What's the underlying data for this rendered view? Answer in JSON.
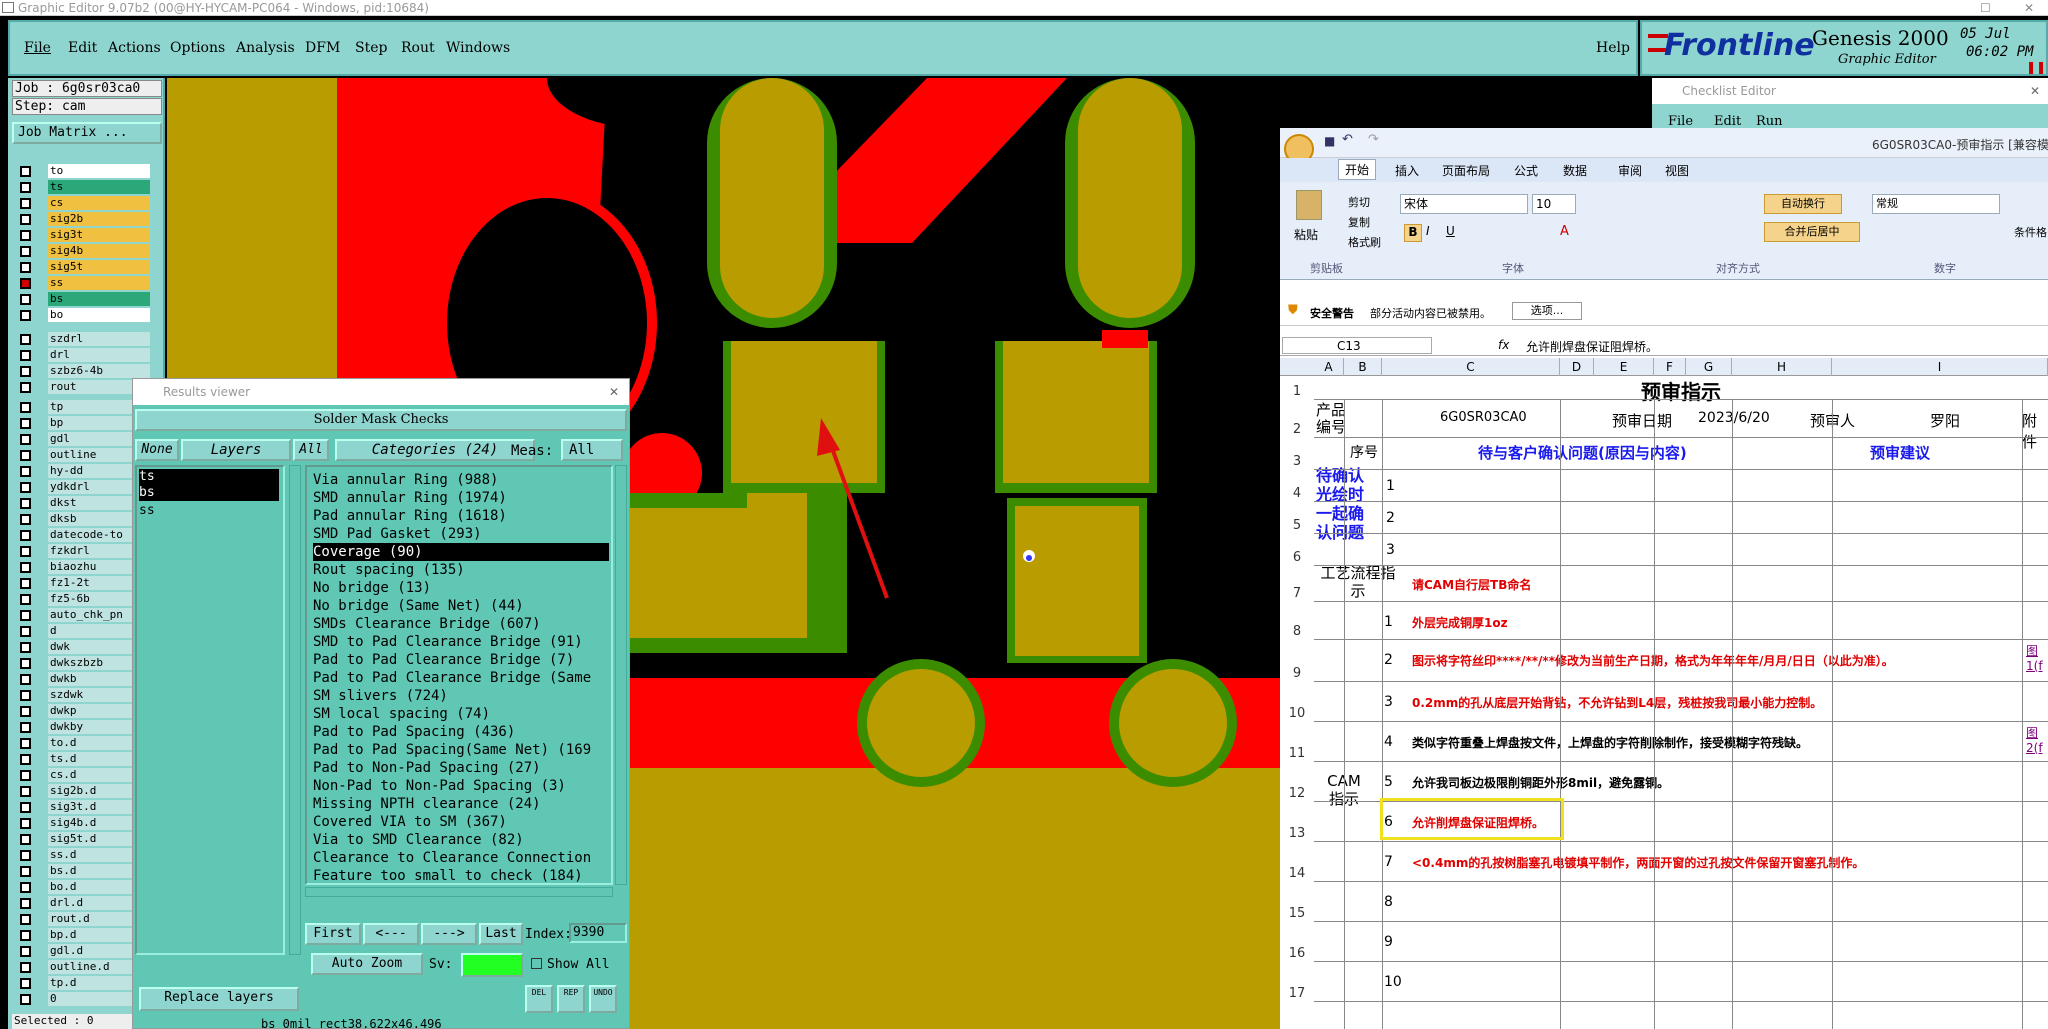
{
  "app": {
    "title": "Graphic Editor 9.07b2 (00@HY-HYCAM-PC064 - Windows, pid:10684)",
    "help": "Help"
  },
  "menu": [
    "File",
    "Edit",
    "Actions",
    "Options",
    "Analysis",
    "DFM",
    "Step",
    "Rout",
    "Windows"
  ],
  "logo": {
    "brand": "Frontline",
    "product": "Genesis 2000",
    "sub": "Graphic Editor",
    "date": "05 Jul",
    "time": "06:02 PM"
  },
  "job": {
    "job_label": "Job : 6g0sr03ca0",
    "step_label": "Step: cam",
    "matrix_button": "Job Matrix ...",
    "selected": "Selected : 0"
  },
  "layers": [
    "to",
    "ts",
    "cs",
    "sig2b",
    "sig3t",
    "sig4b",
    "sig5t",
    "ss",
    "bs",
    "bo",
    "szdrl",
    "drl",
    "szbz6-4b",
    "rout",
    "tp",
    "bp",
    "gdl",
    "outline",
    "hy-dd",
    "ydkdrl",
    "dkst",
    "dksb",
    "datecode-to",
    "fzkdrl",
    "biaozhu",
    "fz1-2t",
    "fz5-6b",
    "auto_chk_pn",
    "d",
    "dwk",
    "dwkszbzb",
    "dwkb",
    "szdwk",
    "dwkp",
    "dwkby",
    "to.d",
    "ts.d",
    "cs.d",
    "sig2b.d",
    "sig3t.d",
    "sig4b.d",
    "sig5t.d",
    "ss.d",
    "bs.d",
    "bo.d",
    "drl.d",
    "rout.d",
    "bp.d",
    "gdl.d",
    "outline.d",
    "tp.d",
    "0"
  ],
  "layer_colors": {
    "to": "#ffffff",
    "ts": "#2aa87a",
    "cs": "#f0c040",
    "sig2b": "#f0c040",
    "sig3t": "#f0c040",
    "sig4b": "#f0c040",
    "sig5t": "#f0c040",
    "ss": "#f0c040",
    "bs": "#2aa87a",
    "bo": "#ffffff"
  },
  "checklist": {
    "title": "Checklist Editor",
    "menu": [
      "File",
      "Edit",
      "Run"
    ]
  },
  "results": {
    "window_title": "Results viewer",
    "header": "Solder Mask Checks",
    "none_btn": "None",
    "layers_btn": "Layers",
    "all_btn": "All",
    "categories_btn": "Categories (24)",
    "meas_label": "Meas:",
    "meas_value": "All",
    "result_layers": [
      "ts",
      "bs",
      "ss"
    ],
    "categories": [
      "Via annular Ring (988)",
      "SMD annular Ring (1974)",
      "Pad annular Ring (1618)",
      "SMD Pad Gasket (293)",
      "Coverage (90)",
      "Rout spacing (135)",
      "No bridge (13)",
      "No bridge (Same Net) (44)",
      "SMDs Clearance Bridge (607)",
      "SMD to Pad Clearance Bridge (91)",
      "Pad to Pad Clearance Bridge (7)",
      "Pad to Pad Clearance Bridge (Same",
      "SM slivers (724)",
      "SM local spacing (74)",
      "Pad to Pad Spacing (436)",
      "Pad to Pad Spacing(Same Net) (169",
      "Pad to Non-Pad Spacing (27)",
      "Non-Pad to Non-Pad Spacing (3)",
      "Missing NPTH clearance (24)",
      "Covered VIA to SM (367)",
      "Via to SMD Clearance (82)",
      "Clearance to Clearance Connection",
      "Feature too small to check (184)"
    ],
    "selected_category": "Coverage (90)",
    "first": "First",
    "prev": "<---",
    "next": "--->",
    "last": "Last",
    "index_label": "Index:",
    "index_value": "9390",
    "auto_zoom": "Auto Zoom",
    "sv_label": "Sv:",
    "show_all": "Show All",
    "replace_layers": "Replace layers",
    "status": "bs 0mil   rect38.622x46.496",
    "icons": [
      "DEL",
      "REP",
      "UNDO"
    ]
  },
  "excel": {
    "title": "6G0SR03CA0-预审指示 [兼容模",
    "tabs": [
      "开始",
      "插入",
      "页面布局",
      "公式",
      "数据",
      "审阅",
      "视图"
    ],
    "clipboard": {
      "paste": "粘贴",
      "cut": "剪切",
      "copy": "复制",
      "format": "格式刷",
      "group": "剪贴板"
    },
    "font": {
      "name": "宋体",
      "size": "10",
      "group": "字体"
    },
    "align": {
      "wrap": "自动换行",
      "merge": "合并后居中",
      "group": "对齐方式"
    },
    "number": {
      "format": "常规",
      "group": "数字",
      "cond": "条件格"
    },
    "security": {
      "label": "安全警告",
      "msg": "部分活动内容已被禁用。",
      "btn": "选项..."
    },
    "cellref": "C13",
    "formula": "允许削焊盘保证阻焊桥。",
    "cols": [
      "A",
      "B",
      "C",
      "D",
      "E",
      "F",
      "G",
      "H",
      "I"
    ],
    "sheet_title": "预审指示",
    "product_label": "产品编号",
    "product": "6G0SR03CA0",
    "date_label": "预审日期",
    "date": "2023/6/20",
    "reviewer_label": "预审人",
    "reviewer": "罗阳",
    "attach": "附件",
    "seq": "序号",
    "issue_header": "待与客户确认问题(原因与内容)",
    "suggest_header": "预审建议",
    "pending_label": "待确认光绘时一起确认问题",
    "process_label": "工艺流程指示",
    "process_text": "请CAM自行层TB命名",
    "cam_label": "CAM指示",
    "cam_rows": [
      {
        "n": "1",
        "text": "外层完成铜厚1oz",
        "color": "red"
      },
      {
        "n": "2",
        "text": "图示将字符丝印****/**/**修改为当前生产日期，格式为年年年年/月月/日日（以此为准）。",
        "color": "red",
        "attach": "图1(f"
      },
      {
        "n": "3",
        "text": "0.2mm的孔从底层开始背钻，不允许钻到L4层，残桩按我司最小能力控制。",
        "color": "red"
      },
      {
        "n": "4",
        "text": "类似字符重叠上焊盘按文件，上焊盘的字符削除制作，接受模糊字符残缺。",
        "color": "black",
        "attach": "图2(f"
      },
      {
        "n": "5",
        "text": "允许我司板边极限削铜距外形8mil，避免露铜。",
        "color": "black"
      },
      {
        "n": "6",
        "text": "允许削焊盘保证阻焊桥。",
        "color": "red"
      },
      {
        "n": "7",
        "text": "<0.4mm的孔按树脂塞孔电镀填平制作，两面开窗的过孔按文件保留开窗塞孔制作。",
        "color": "red"
      },
      {
        "n": "8",
        "text": ""
      },
      {
        "n": "9",
        "text": ""
      },
      {
        "n": "10",
        "text": ""
      }
    ],
    "row_numbers": [
      "1",
      "2",
      "3",
      "4",
      "5",
      "6",
      "7",
      "8",
      "9",
      "10",
      "11",
      "12",
      "13",
      "14",
      "15",
      "16",
      "17"
    ]
  }
}
